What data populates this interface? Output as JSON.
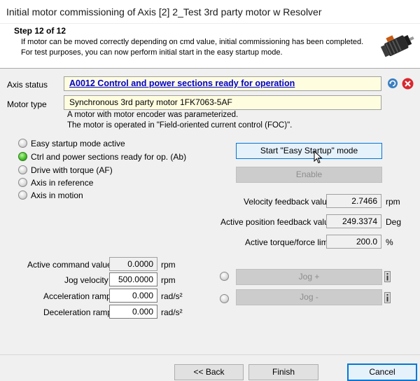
{
  "window": {
    "title": "Initial motor commissioning of Axis [2] 2_Test 3rd party motor w Resolver"
  },
  "header": {
    "step": "Step 12 of 12",
    "description_line1": "If motor can be moved correctly depending on cmd value, initial commissioning has been completed.",
    "description_line2": "For test purposes, you can now perform initial start in the easy startup mode."
  },
  "axis_status": {
    "label": "Axis status",
    "value": "A0012 Control and power sections ready for operation"
  },
  "motor_type": {
    "label": "Motor type",
    "value": "Synchronous 3rd party motor 1FK7063-5AF",
    "info_line1": "A motor with motor encoder was parameterized.",
    "info_line2": "The motor is operated in \"Field-oriented current control (FOC)\"."
  },
  "status_indicators": [
    {
      "label": "Easy startup mode active",
      "active": false
    },
    {
      "label": "Ctrl and power sections ready for op. (Ab)",
      "active": true
    },
    {
      "label": "Drive with torque (AF)",
      "active": false
    },
    {
      "label": "Axis in reference",
      "active": false
    },
    {
      "label": "Axis in motion",
      "active": false
    }
  ],
  "buttons": {
    "easy_startup": "Start \"Easy Startup\" mode",
    "enable": "Enable",
    "jog_plus": "Jog +",
    "jog_minus": "Jog -",
    "back": "<< Back",
    "finish": "Finish",
    "cancel": "Cancel"
  },
  "feedback": {
    "velocity": {
      "label": "Velocity feedback value",
      "value": "2.7466",
      "unit": "rpm"
    },
    "position": {
      "label": "Active position feedback value",
      "value": "249.3374",
      "unit": "Deg"
    },
    "torque": {
      "label": "Active torque/force limit",
      "value": "200.0",
      "unit": "%"
    }
  },
  "jog_params": {
    "command": {
      "label": "Active command value",
      "value": "0.0000",
      "unit": "rpm"
    },
    "velocity": {
      "label": "Jog velocity",
      "value": "500.0000",
      "unit": "rpm"
    },
    "accel": {
      "label": "Acceleration ramp",
      "value": "0.000",
      "unit": "rad/s²"
    },
    "decel": {
      "label": "Deceleration ramp",
      "value": "0.000",
      "unit": "rad/s²"
    }
  },
  "colors": {
    "accent": "#0078d7",
    "status_field_bg": "#fffde0",
    "link": "#0000cc",
    "active_led": "#48c22a",
    "close_icon": "#d9272e"
  },
  "icons": [
    "motor-image",
    "refresh-icon",
    "close-icon",
    "jog-plus-radio-icon",
    "jog-minus-radio-icon",
    "info-icon"
  ]
}
